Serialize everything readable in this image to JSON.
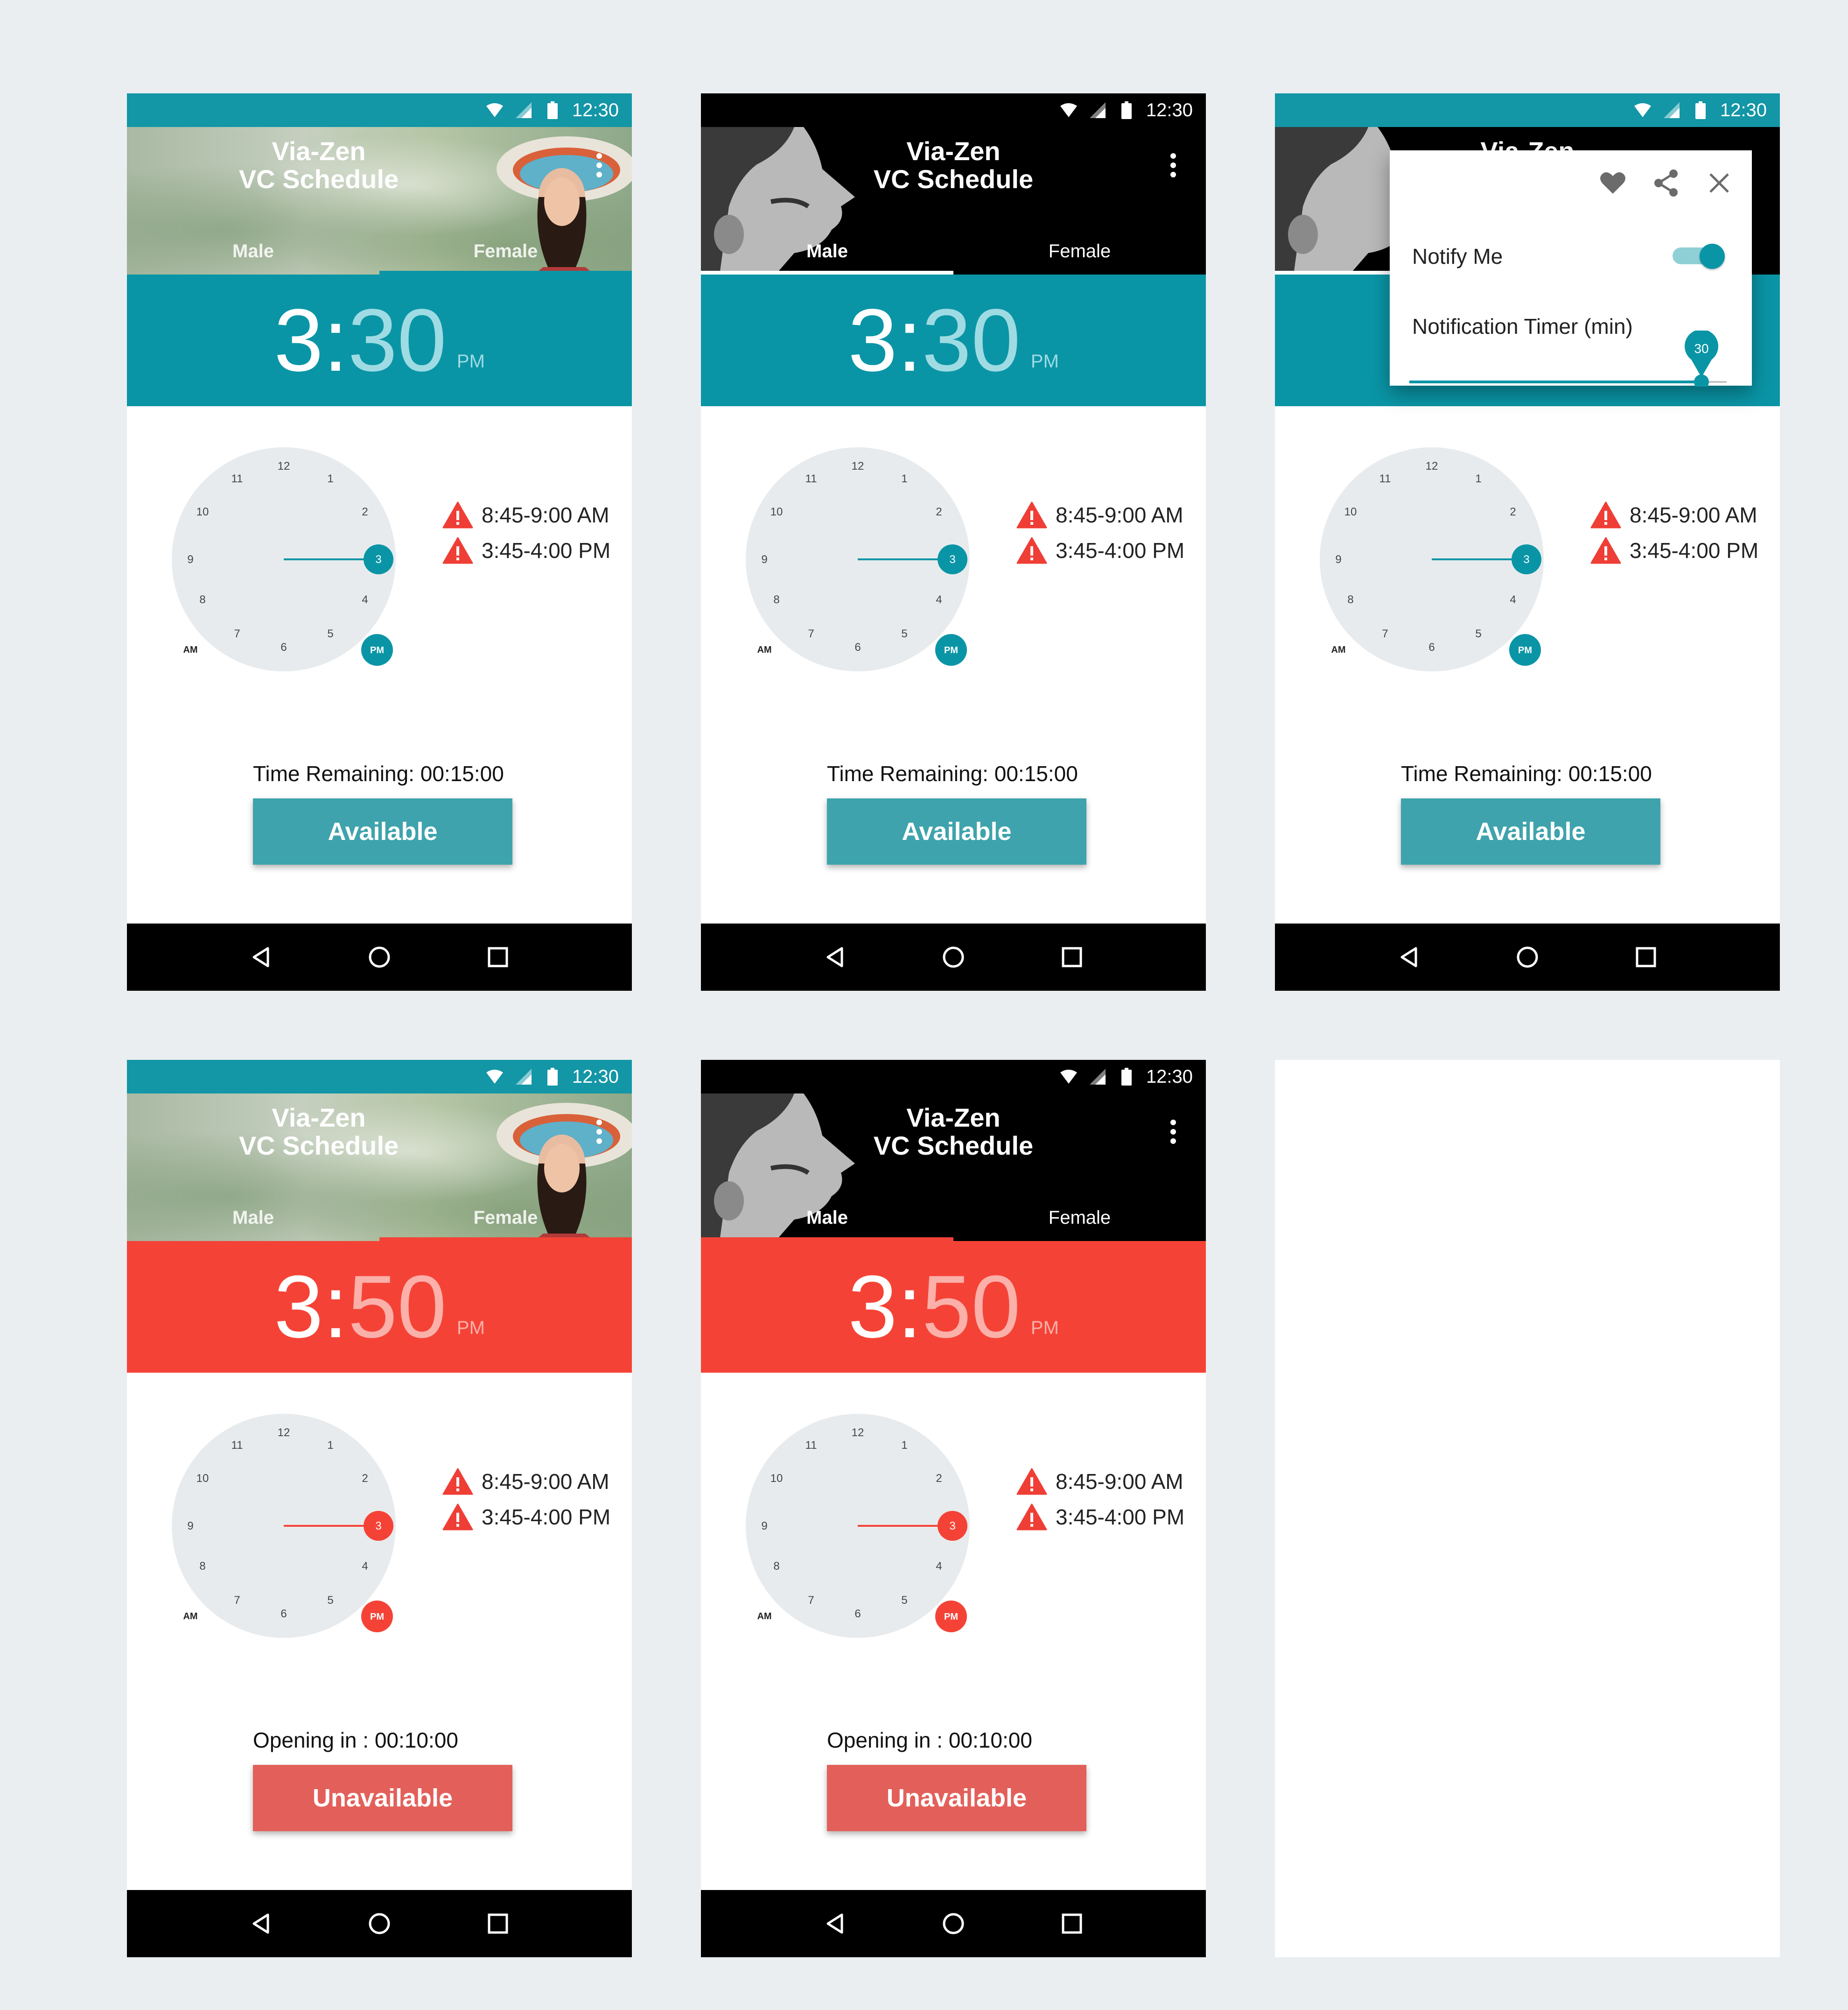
{
  "status_bar": {
    "time": "12:30"
  },
  "app": {
    "title_line1": "Via-Zen",
    "title_line2": "VC Schedule"
  },
  "tabs": {
    "male": "Male",
    "female": "Female"
  },
  "clock": {
    "numbers": [
      "12",
      "1",
      "2",
      "3",
      "4",
      "5",
      "6",
      "7",
      "8",
      "9",
      "10",
      "11"
    ],
    "am_label": "AM",
    "pm_label": "PM",
    "selected_hour": "3"
  },
  "schedule_slots": [
    "8:45-9:00 AM",
    "3:45-4:00 PM"
  ],
  "screens": {
    "available": {
      "hour": "3",
      "sep": ":",
      "minute": "30",
      "ampm": "PM",
      "remaining": "Time Remaining: 00:15:00",
      "button": "Available",
      "accent": "#0a95a6"
    },
    "unavailable": {
      "hour": "3",
      "sep": ":",
      "minute": "50",
      "ampm": "PM",
      "remaining": "Opening in : 00:10:00",
      "button": "Unavailable",
      "accent": "#f44336"
    }
  },
  "popup": {
    "notify_label": "Notify Me",
    "notify_on": true,
    "timer_label": "Notification Timer (min)",
    "timer_value": "30",
    "timer_fraction": 0.92
  },
  "icons": [
    "wifi-icon",
    "signal-icon",
    "battery-icon",
    "more-vert-icon",
    "warning-icon",
    "heart-icon",
    "share-icon",
    "close-icon",
    "back-icon",
    "home-icon",
    "recents-icon"
  ]
}
